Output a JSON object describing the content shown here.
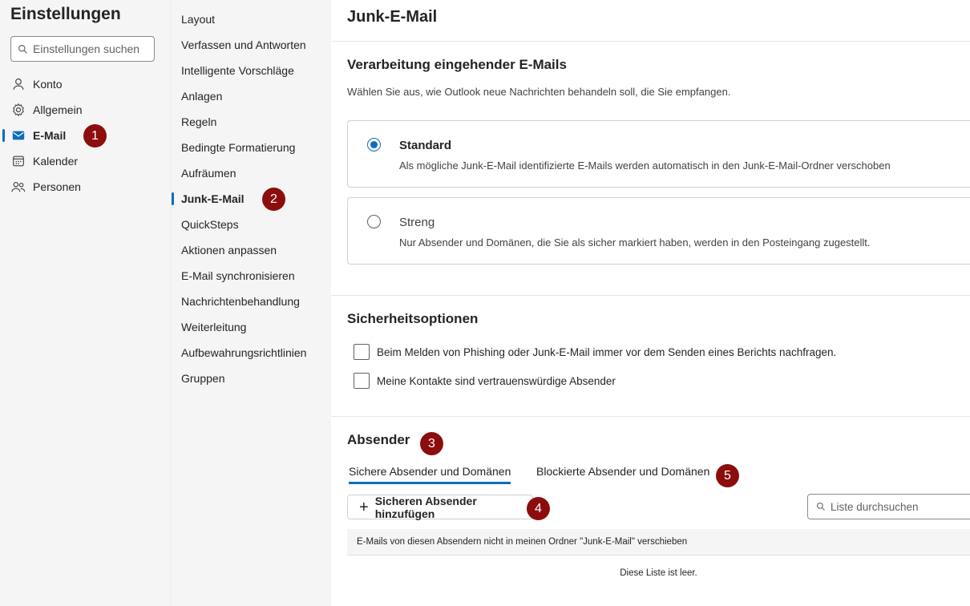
{
  "app": {
    "title": "Einstellungen",
    "search_placeholder": "Einstellungen suchen"
  },
  "nav_primary": [
    {
      "label": "Konto",
      "icon": "person-icon"
    },
    {
      "label": "Allgemein",
      "icon": "gear-icon"
    },
    {
      "label": "E-Mail",
      "icon": "mail-icon",
      "active": true
    },
    {
      "label": "Kalender",
      "icon": "calendar-icon"
    },
    {
      "label": "Personen",
      "icon": "people-icon"
    }
  ],
  "nav_secondary": [
    {
      "label": "Layout"
    },
    {
      "label": "Verfassen und Antworten"
    },
    {
      "label": "Intelligente Vorschläge"
    },
    {
      "label": "Anlagen"
    },
    {
      "label": "Regeln"
    },
    {
      "label": "Bedingte Formatierung"
    },
    {
      "label": "Aufräumen"
    },
    {
      "label": "Junk-E-Mail",
      "active": true
    },
    {
      "label": "QuickSteps"
    },
    {
      "label": "Aktionen anpassen"
    },
    {
      "label": "E-Mail synchronisieren"
    },
    {
      "label": "Nachrichtenbehandlung"
    },
    {
      "label": "Weiterleitung"
    },
    {
      "label": "Aufbewahrungsrichtlinien"
    },
    {
      "label": "Gruppen"
    }
  ],
  "main": {
    "title": "Junk-E-Mail",
    "incoming": {
      "heading": "Verarbeitung eingehender E-Mails",
      "description": "Wählen Sie aus, wie Outlook neue Nachrichten behandeln soll, die Sie empfangen.",
      "options": [
        {
          "title": "Standard",
          "description": "Als mögliche Junk-E-Mail identifizierte E-Mails werden automatisch in den Junk-E-Mail-Ordner verschoben",
          "selected": true
        },
        {
          "title": "Streng",
          "description": "Nur Absender und Domänen, die Sie als sicher markiert haben, werden in den Posteingang zugestellt.",
          "selected": false
        }
      ]
    },
    "security": {
      "heading": "Sicherheitsoptionen",
      "checkboxes": [
        {
          "label": "Beim Melden von Phishing oder Junk-E-Mail immer vor dem Senden eines Berichts nachfragen.",
          "checked": false
        },
        {
          "label": "Meine Kontakte sind vertrauenswürdige Absender",
          "checked": false
        }
      ]
    },
    "senders": {
      "heading": "Absender",
      "tabs": [
        {
          "label": "Sichere Absender und Domänen",
          "active": true
        },
        {
          "label": "Blockierte Absender und Domänen",
          "active": false
        }
      ],
      "add_button": "Sicheren Absender hinzufügen",
      "list_search_placeholder": "Liste durchsuchen",
      "table_header": "E-Mails von diesen Absendern nicht in meinen Ordner \"Junk-E-Mail\" verschieben",
      "empty_text": "Diese Liste ist leer."
    }
  },
  "badges": [
    "1",
    "2",
    "3",
    "4",
    "5"
  ],
  "colors": {
    "accent": "#0f6cbd",
    "badge": "#8b0d0d",
    "sidebar_bg": "#f5f5f5"
  }
}
